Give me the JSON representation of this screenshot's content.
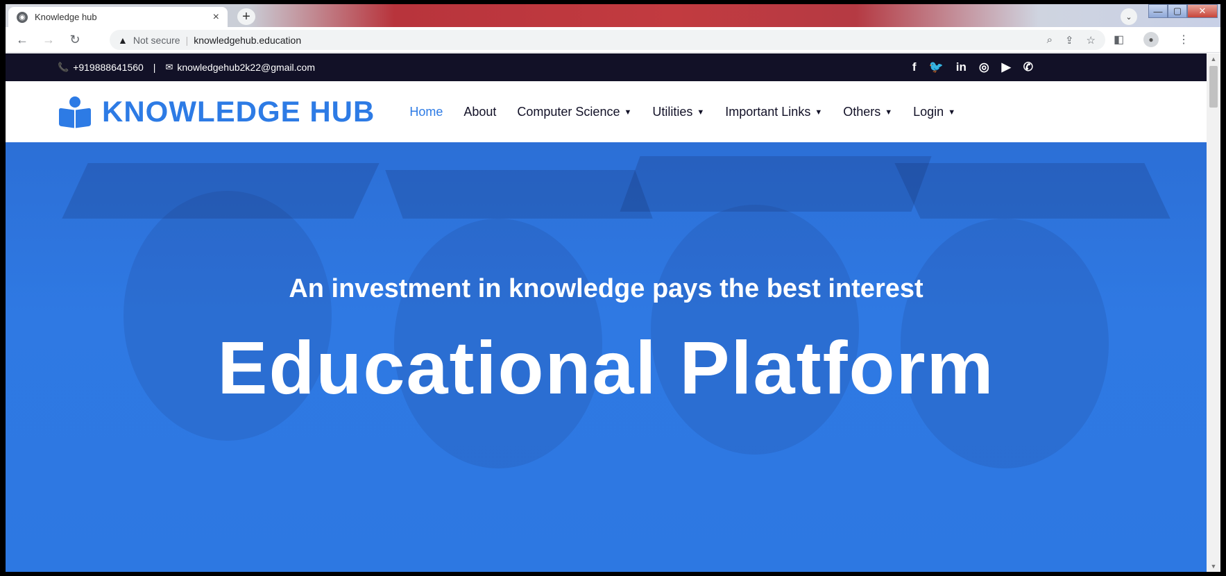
{
  "browser": {
    "tab_title": "Knowledge hub",
    "tab_close": "×",
    "new_tab": "+",
    "security_label": "Not secure",
    "url": "knowledgehub.education"
  },
  "site": {
    "topbar": {
      "phone": "+919888641560",
      "separator": "|",
      "email": "knowledgehub2k22@gmail.com",
      "social": [
        "f",
        "🐦",
        "in",
        "◎",
        "▶",
        "✆"
      ]
    },
    "brand": "KNOWLEDGE HUB",
    "nav": [
      {
        "label": "Home"
      },
      {
        "label": "About"
      },
      {
        "label": "Computer Science"
      },
      {
        "label": "Utilities"
      },
      {
        "label": "Important Links"
      },
      {
        "label": "Others"
      },
      {
        "label": "Login"
      }
    ],
    "hero": {
      "tagline": "An investment in knowledge pays the best interest",
      "headline": "Educational Platform"
    }
  },
  "colors": {
    "brand_blue": "#2d7be5",
    "topbar_dark": "#121127"
  }
}
